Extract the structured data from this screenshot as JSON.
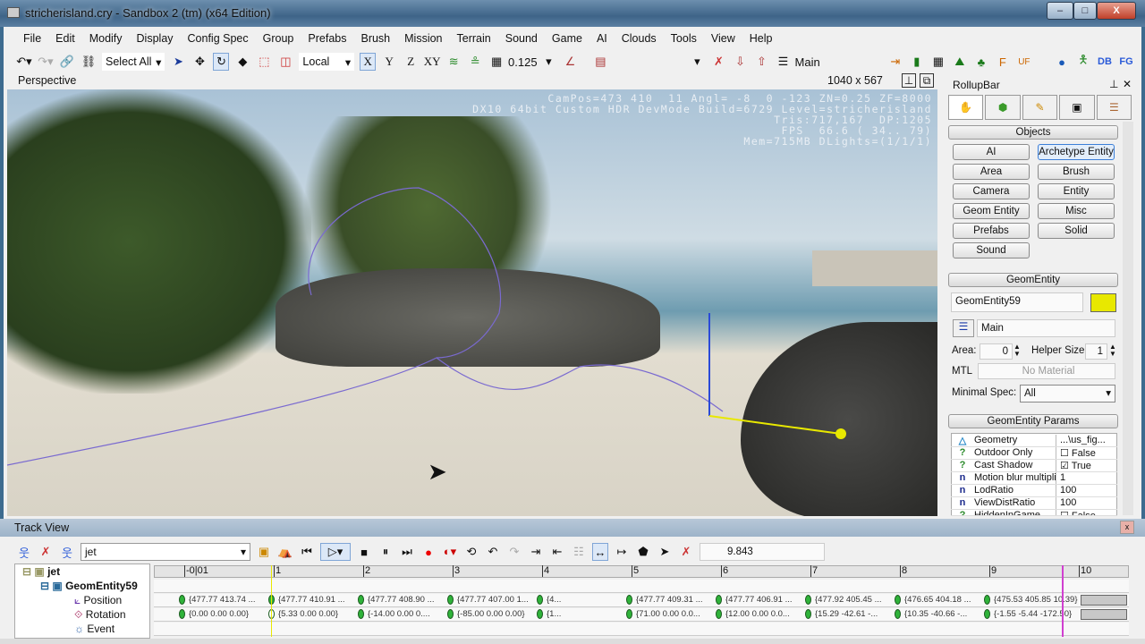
{
  "window": {
    "title": "stricherisland.cry - Sandbox 2 (tm) (x64 Edition)",
    "min": "–",
    "max": "□",
    "close": "X"
  },
  "menu": [
    "File",
    "Edit",
    "Modify",
    "Display",
    "Config Spec",
    "Group",
    "Prefabs",
    "Brush",
    "Mission",
    "Terrain",
    "Sound",
    "Game",
    "AI",
    "Clouds",
    "Tools",
    "View",
    "Help"
  ],
  "toolbar": {
    "selection": "Select All",
    "coord_system": "Local",
    "axes": [
      "X",
      "Y",
      "Z",
      "XY"
    ],
    "snap": "0.125",
    "layer": "Main",
    "right_labels": [
      "DB",
      "FG"
    ]
  },
  "viewport": {
    "label": "Perspective",
    "resolution": "1040 x 567",
    "hud": [
      "CamPos=473 410  11 Angl= -8  0 -123 ZN=0.25 ZF=8000",
      "DX10 64bit Custom HDR DevMode Build=6729 Level=stricherisland",
      "Tris:717,167  DP:1205",
      "FPS  66.6 ( 34.. 79)",
      "Mem=715MB DLights=(1/1/1)"
    ]
  },
  "rollup": {
    "title": "RollupBar",
    "objects_header": "Objects",
    "object_buttons": [
      "AI",
      "Archetype Entity",
      "Area",
      "Brush",
      "Camera",
      "Entity",
      "Geom Entity",
      "Misc",
      "Prefabs",
      "Solid",
      "Sound"
    ],
    "selected_button": "Archetype Entity",
    "entity_header": "GeomEntity",
    "entity_name": "GeomEntity59",
    "entity_color": "#e8e800",
    "layer": "Main",
    "area_label": "Area:",
    "area_value": "0",
    "helper_label": "Helper Size:",
    "helper_value": "1",
    "mtl_label": "MTL",
    "mtl_value": "No Material",
    "minspec_label": "Minimal Spec:",
    "minspec_value": "All",
    "params_header": "GeomEntity Params",
    "params": [
      {
        "icon": "△",
        "name": "Geometry",
        "value": "...\\us_fig..."
      },
      {
        "icon": "?",
        "name": "Outdoor Only",
        "value": "☐ False"
      },
      {
        "icon": "?",
        "name": "Cast Shadow",
        "value": "☑ True"
      },
      {
        "icon": "n",
        "name": "Motion blur multipli",
        "value": "1"
      },
      {
        "icon": "n",
        "name": "LodRatio",
        "value": "100"
      },
      {
        "icon": "n",
        "name": "ViewDistRatio",
        "value": "100"
      },
      {
        "icon": "?",
        "name": "HiddenInGame",
        "value": "☐ False"
      }
    ]
  },
  "trackview": {
    "title": "Track View",
    "sequence": "jet",
    "time": "9.843",
    "tree": [
      {
        "label": "jet"
      },
      {
        "label": "GeomEntity59"
      },
      {
        "label": "Position"
      },
      {
        "label": "Rotation"
      },
      {
        "label": "Event"
      }
    ],
    "ruler": [
      "-0|01",
      "1",
      "2",
      "3",
      "4",
      "5",
      "6",
      "7",
      "8",
      "9",
      "10"
    ],
    "position_keys": [
      "{477.77  413.74 ...",
      "{477.77  410.91 ...",
      "{477.77  408.90 ...",
      "{477.77  407.00  1...",
      "{4...",
      "{477.77  409.31 ...",
      "{477.77  406.91 ...",
      "{477.92  405.45 ...",
      "{476.65  404.18 ...",
      "{475.53  405.85  10.39}"
    ],
    "rotation_keys": [
      "{0.00  0.00  0.00}",
      "{5.33  0.00  0.00}",
      "{-14.00  0.00  0....",
      "{-85.00  0.00  0.00}",
      "{1...",
      "{71.00  0.00  0.0...",
      "{12.00  0.00  0.0...",
      "{15.29  -42.61  -...",
      "{10.35  -40.66  -...",
      "{-1.55  -5.44  -172.50}"
    ]
  }
}
